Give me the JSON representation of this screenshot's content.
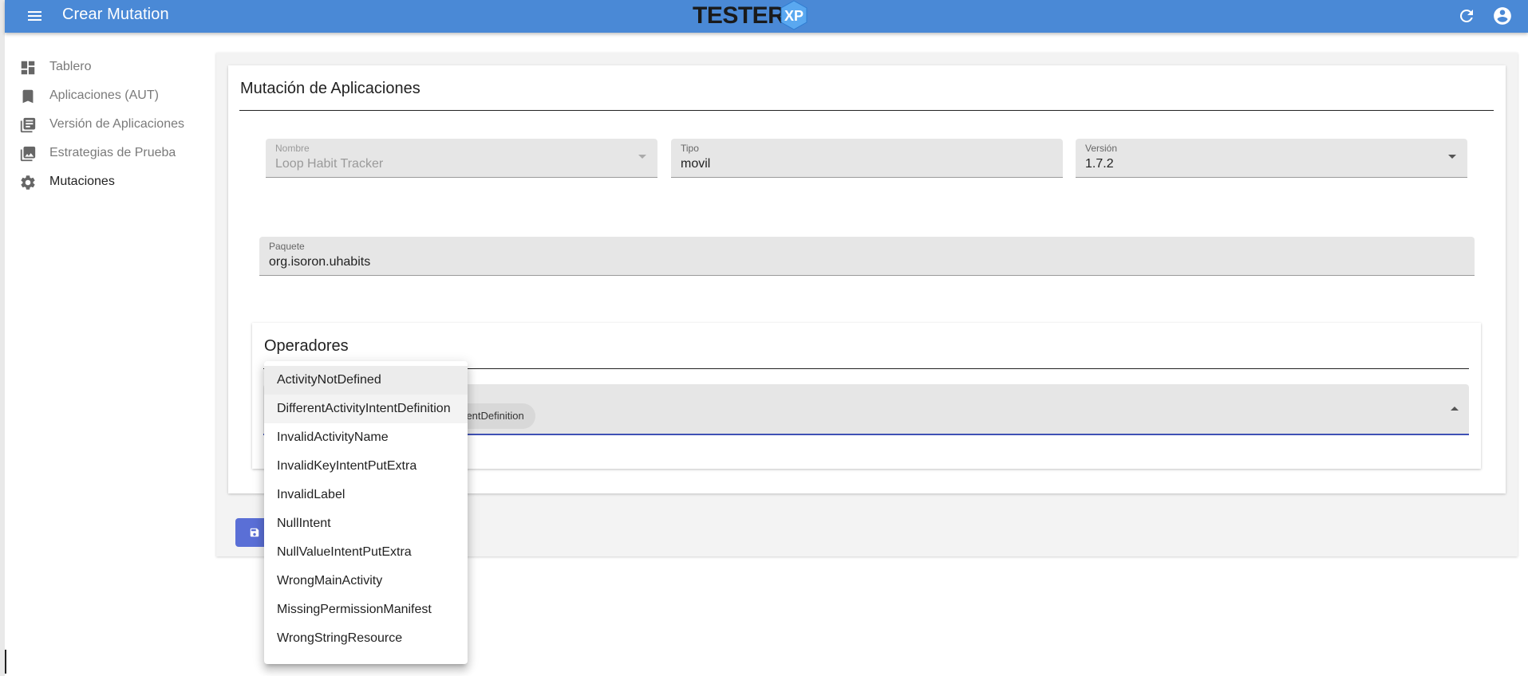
{
  "header": {
    "title": "Crear Mutation",
    "logo_text": "TESTER",
    "logo_badge": "XP"
  },
  "sidebar": {
    "items": [
      {
        "label": "Tablero",
        "icon": "dashboard-icon"
      },
      {
        "label": "Aplicaciones (AUT)",
        "icon": "bookmark-icon"
      },
      {
        "label": "Versión de Aplicaciones",
        "icon": "library-books-icon"
      },
      {
        "label": "Estrategias de Prueba",
        "icon": "photo-library-icon"
      },
      {
        "label": "Mutaciones",
        "icon": "gear-icon",
        "active": true
      }
    ]
  },
  "form": {
    "section_title": "Mutación de Aplicaciones",
    "nombre": {
      "label": "Nombre",
      "value": "Loop Habit Tracker"
    },
    "tipo": {
      "label": "Tipo",
      "value": "movil"
    },
    "version": {
      "label": "Versión",
      "value": "1.7.2"
    },
    "paquete": {
      "label": "Paquete",
      "value": "org.isoron.uhabits"
    }
  },
  "operators": {
    "title": "Operadores",
    "selected_chip_text": "IntentDefinition",
    "options": [
      "ActivityNotDefined",
      "DifferentActivityIntentDefinition",
      "InvalidActivityName",
      "InvalidKeyIntentPutExtra",
      "InvalidLabel",
      "NullIntent",
      "NullValueIntentPutExtra",
      "WrongMainActivity",
      "MissingPermissionManifest",
      "WrongStringResource"
    ]
  },
  "colors": {
    "topbar": "#4a89d6",
    "accent": "#3f51b5",
    "save_button": "#5a6fd6"
  }
}
